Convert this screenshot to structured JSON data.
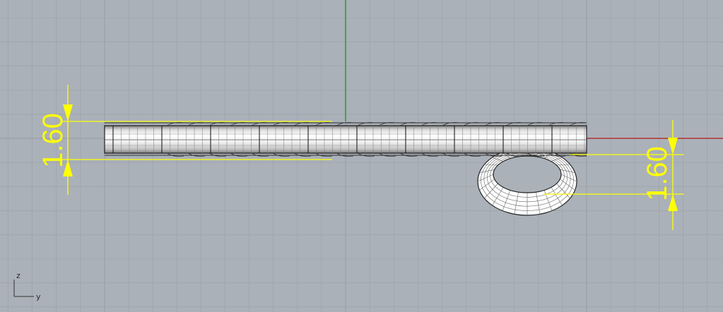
{
  "viewport": {
    "background_color": "#aab1b9",
    "grid_color": "#9aa1a8",
    "y_axis_color": "#19a019",
    "x_axis_color": "#b43232",
    "dimension_color": "#ffff00"
  },
  "dimensions": {
    "left_value": "1.60",
    "right_value": "1.60"
  },
  "axis_gizmo": {
    "vertical_label": "z",
    "horizontal_label": "y"
  }
}
